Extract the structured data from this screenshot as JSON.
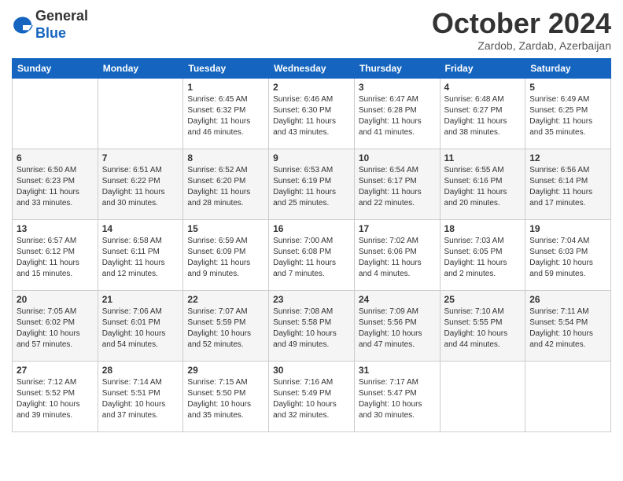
{
  "header": {
    "logo_general": "General",
    "logo_blue": "Blue",
    "month_title": "October 2024",
    "location": "Zardob, Zardab, Azerbaijan"
  },
  "weekdays": [
    "Sunday",
    "Monday",
    "Tuesday",
    "Wednesday",
    "Thursday",
    "Friday",
    "Saturday"
  ],
  "weeks": [
    [
      {
        "day": "",
        "content": ""
      },
      {
        "day": "",
        "content": ""
      },
      {
        "day": "1",
        "content": "Sunrise: 6:45 AM\nSunset: 6:32 PM\nDaylight: 11 hours and 46 minutes."
      },
      {
        "day": "2",
        "content": "Sunrise: 6:46 AM\nSunset: 6:30 PM\nDaylight: 11 hours and 43 minutes."
      },
      {
        "day": "3",
        "content": "Sunrise: 6:47 AM\nSunset: 6:28 PM\nDaylight: 11 hours and 41 minutes."
      },
      {
        "day": "4",
        "content": "Sunrise: 6:48 AM\nSunset: 6:27 PM\nDaylight: 11 hours and 38 minutes."
      },
      {
        "day": "5",
        "content": "Sunrise: 6:49 AM\nSunset: 6:25 PM\nDaylight: 11 hours and 35 minutes."
      }
    ],
    [
      {
        "day": "6",
        "content": "Sunrise: 6:50 AM\nSunset: 6:23 PM\nDaylight: 11 hours and 33 minutes."
      },
      {
        "day": "7",
        "content": "Sunrise: 6:51 AM\nSunset: 6:22 PM\nDaylight: 11 hours and 30 minutes."
      },
      {
        "day": "8",
        "content": "Sunrise: 6:52 AM\nSunset: 6:20 PM\nDaylight: 11 hours and 28 minutes."
      },
      {
        "day": "9",
        "content": "Sunrise: 6:53 AM\nSunset: 6:19 PM\nDaylight: 11 hours and 25 minutes."
      },
      {
        "day": "10",
        "content": "Sunrise: 6:54 AM\nSunset: 6:17 PM\nDaylight: 11 hours and 22 minutes."
      },
      {
        "day": "11",
        "content": "Sunrise: 6:55 AM\nSunset: 6:16 PM\nDaylight: 11 hours and 20 minutes."
      },
      {
        "day": "12",
        "content": "Sunrise: 6:56 AM\nSunset: 6:14 PM\nDaylight: 11 hours and 17 minutes."
      }
    ],
    [
      {
        "day": "13",
        "content": "Sunrise: 6:57 AM\nSunset: 6:12 PM\nDaylight: 11 hours and 15 minutes."
      },
      {
        "day": "14",
        "content": "Sunrise: 6:58 AM\nSunset: 6:11 PM\nDaylight: 11 hours and 12 minutes."
      },
      {
        "day": "15",
        "content": "Sunrise: 6:59 AM\nSunset: 6:09 PM\nDaylight: 11 hours and 9 minutes."
      },
      {
        "day": "16",
        "content": "Sunrise: 7:00 AM\nSunset: 6:08 PM\nDaylight: 11 hours and 7 minutes."
      },
      {
        "day": "17",
        "content": "Sunrise: 7:02 AM\nSunset: 6:06 PM\nDaylight: 11 hours and 4 minutes."
      },
      {
        "day": "18",
        "content": "Sunrise: 7:03 AM\nSunset: 6:05 PM\nDaylight: 11 hours and 2 minutes."
      },
      {
        "day": "19",
        "content": "Sunrise: 7:04 AM\nSunset: 6:03 PM\nDaylight: 10 hours and 59 minutes."
      }
    ],
    [
      {
        "day": "20",
        "content": "Sunrise: 7:05 AM\nSunset: 6:02 PM\nDaylight: 10 hours and 57 minutes."
      },
      {
        "day": "21",
        "content": "Sunrise: 7:06 AM\nSunset: 6:01 PM\nDaylight: 10 hours and 54 minutes."
      },
      {
        "day": "22",
        "content": "Sunrise: 7:07 AM\nSunset: 5:59 PM\nDaylight: 10 hours and 52 minutes."
      },
      {
        "day": "23",
        "content": "Sunrise: 7:08 AM\nSunset: 5:58 PM\nDaylight: 10 hours and 49 minutes."
      },
      {
        "day": "24",
        "content": "Sunrise: 7:09 AM\nSunset: 5:56 PM\nDaylight: 10 hours and 47 minutes."
      },
      {
        "day": "25",
        "content": "Sunrise: 7:10 AM\nSunset: 5:55 PM\nDaylight: 10 hours and 44 minutes."
      },
      {
        "day": "26",
        "content": "Sunrise: 7:11 AM\nSunset: 5:54 PM\nDaylight: 10 hours and 42 minutes."
      }
    ],
    [
      {
        "day": "27",
        "content": "Sunrise: 7:12 AM\nSunset: 5:52 PM\nDaylight: 10 hours and 39 minutes."
      },
      {
        "day": "28",
        "content": "Sunrise: 7:14 AM\nSunset: 5:51 PM\nDaylight: 10 hours and 37 minutes."
      },
      {
        "day": "29",
        "content": "Sunrise: 7:15 AM\nSunset: 5:50 PM\nDaylight: 10 hours and 35 minutes."
      },
      {
        "day": "30",
        "content": "Sunrise: 7:16 AM\nSunset: 5:49 PM\nDaylight: 10 hours and 32 minutes."
      },
      {
        "day": "31",
        "content": "Sunrise: 7:17 AM\nSunset: 5:47 PM\nDaylight: 10 hours and 30 minutes."
      },
      {
        "day": "",
        "content": ""
      },
      {
        "day": "",
        "content": ""
      }
    ]
  ]
}
